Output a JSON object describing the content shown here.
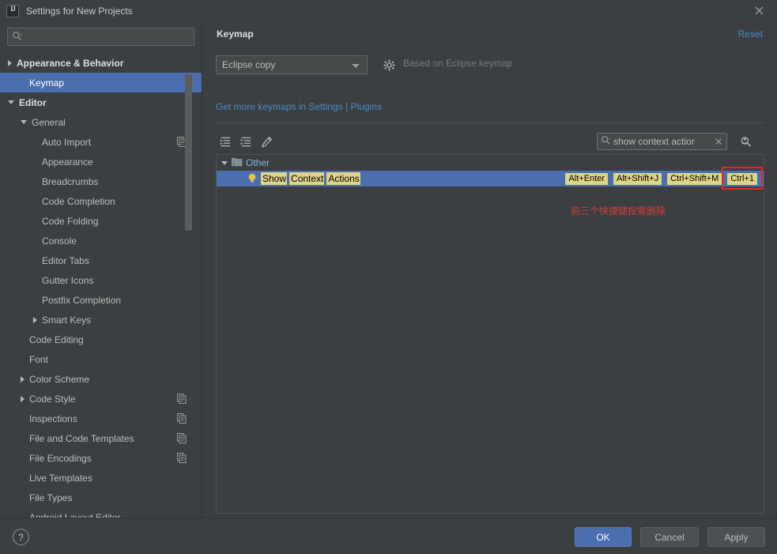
{
  "window": {
    "title": "Settings for New Projects",
    "app_icon": "intellij-idea-logo-icon",
    "close_icon": "close-icon"
  },
  "sidebar": {
    "search": {
      "value": "",
      "placeholder": "",
      "icon": "search-icon"
    },
    "items": [
      {
        "label": "Appearance & Behavior",
        "indent": 0,
        "arrow": "right",
        "bold": true,
        "selected": false,
        "copy": false
      },
      {
        "label": "Keymap",
        "indent": 1,
        "arrow": "none",
        "bold": false,
        "selected": true,
        "copy": false
      },
      {
        "label": "Editor",
        "indent": 0,
        "arrow": "down",
        "bold": true,
        "selected": false,
        "copy": false
      },
      {
        "label": "General",
        "indent": 1,
        "arrow": "down",
        "bold": false,
        "selected": false,
        "copy": false
      },
      {
        "label": "Auto Import",
        "indent": 2,
        "arrow": "none",
        "bold": false,
        "selected": false,
        "copy": true
      },
      {
        "label": "Appearance",
        "indent": 2,
        "arrow": "none",
        "bold": false,
        "selected": false,
        "copy": false
      },
      {
        "label": "Breadcrumbs",
        "indent": 2,
        "arrow": "none",
        "bold": false,
        "selected": false,
        "copy": false
      },
      {
        "label": "Code Completion",
        "indent": 2,
        "arrow": "none",
        "bold": false,
        "selected": false,
        "copy": false
      },
      {
        "label": "Code Folding",
        "indent": 2,
        "arrow": "none",
        "bold": false,
        "selected": false,
        "copy": false
      },
      {
        "label": "Console",
        "indent": 2,
        "arrow": "none",
        "bold": false,
        "selected": false,
        "copy": false
      },
      {
        "label": "Editor Tabs",
        "indent": 2,
        "arrow": "none",
        "bold": false,
        "selected": false,
        "copy": false
      },
      {
        "label": "Gutter Icons",
        "indent": 2,
        "arrow": "none",
        "bold": false,
        "selected": false,
        "copy": false
      },
      {
        "label": "Postfix Completion",
        "indent": 2,
        "arrow": "none",
        "bold": false,
        "selected": false,
        "copy": false
      },
      {
        "label": "Smart Keys",
        "indent": 2,
        "arrow": "right",
        "bold": false,
        "selected": false,
        "copy": false
      },
      {
        "label": "Code Editing",
        "indent": 1,
        "arrow": "none",
        "bold": false,
        "selected": false,
        "copy": false
      },
      {
        "label": "Font",
        "indent": 1,
        "arrow": "none",
        "bold": false,
        "selected": false,
        "copy": false
      },
      {
        "label": "Color Scheme",
        "indent": 1,
        "arrow": "right",
        "bold": false,
        "selected": false,
        "copy": false
      },
      {
        "label": "Code Style",
        "indent": 1,
        "arrow": "right",
        "bold": false,
        "selected": false,
        "copy": true
      },
      {
        "label": "Inspections",
        "indent": 1,
        "arrow": "none",
        "bold": false,
        "selected": false,
        "copy": true
      },
      {
        "label": "File and Code Templates",
        "indent": 1,
        "arrow": "none",
        "bold": false,
        "selected": false,
        "copy": true
      },
      {
        "label": "File Encodings",
        "indent": 1,
        "arrow": "none",
        "bold": false,
        "selected": false,
        "copy": true
      },
      {
        "label": "Live Templates",
        "indent": 1,
        "arrow": "none",
        "bold": false,
        "selected": false,
        "copy": false
      },
      {
        "label": "File Types",
        "indent": 1,
        "arrow": "none",
        "bold": false,
        "selected": false,
        "copy": false
      },
      {
        "label": "Android Layout Editor",
        "indent": 1,
        "arrow": "none",
        "bold": false,
        "selected": false,
        "copy": false
      }
    ],
    "scrollbar": {
      "name": "sidebar-scrollbar"
    }
  },
  "main": {
    "title": "Keymap",
    "reset_label": "Reset",
    "keymap_select": {
      "value": "Eclipse copy",
      "options": [
        "Eclipse copy"
      ]
    },
    "gear_icon": "gear-icon",
    "based_on": "Based on Eclipse keymap",
    "plugins_link": "Get more keymaps in Settings | Plugins",
    "toolbar": {
      "expand_all_label": "expand-all",
      "collapse_all_label": "collapse-all",
      "edit_label": "edit-shortcut"
    },
    "search": {
      "value": "show context actior",
      "full_value": "show context actions",
      "icon": "search-icon",
      "clear_icon": "clear-icon"
    },
    "find_by_shortcut_icon": "find-by-shortcut-icon",
    "tree": {
      "group": {
        "label": "Other",
        "icon": "folder-icon",
        "expanded": true
      },
      "action": {
        "icon": "lightbulb-icon",
        "words": [
          "Show",
          "Context",
          "Actions"
        ],
        "selected": true,
        "shortcuts": [
          {
            "label": "Alt+Enter",
            "annotated": false
          },
          {
            "label": "Alt+Shift+J",
            "annotated": false
          },
          {
            "label": "Ctrl+Shift+M",
            "annotated": false
          },
          {
            "label": "Ctrl+1",
            "annotated": true
          }
        ]
      }
    },
    "annotation": {
      "text": "前三个快捷键按需删除",
      "color": "#d33c3c"
    }
  },
  "footer": {
    "help_label": "?",
    "ok_label": "OK",
    "cancel_label": "Cancel",
    "apply_label": "Apply"
  },
  "colors": {
    "window_bg": "#3c3f41",
    "selection_blue": "#4b6eaf",
    "link_blue": "#4a88c7",
    "highlight_yellow": "#ddd48b",
    "annotation_red": "#d33c3c",
    "text": "#bbbbbb"
  }
}
